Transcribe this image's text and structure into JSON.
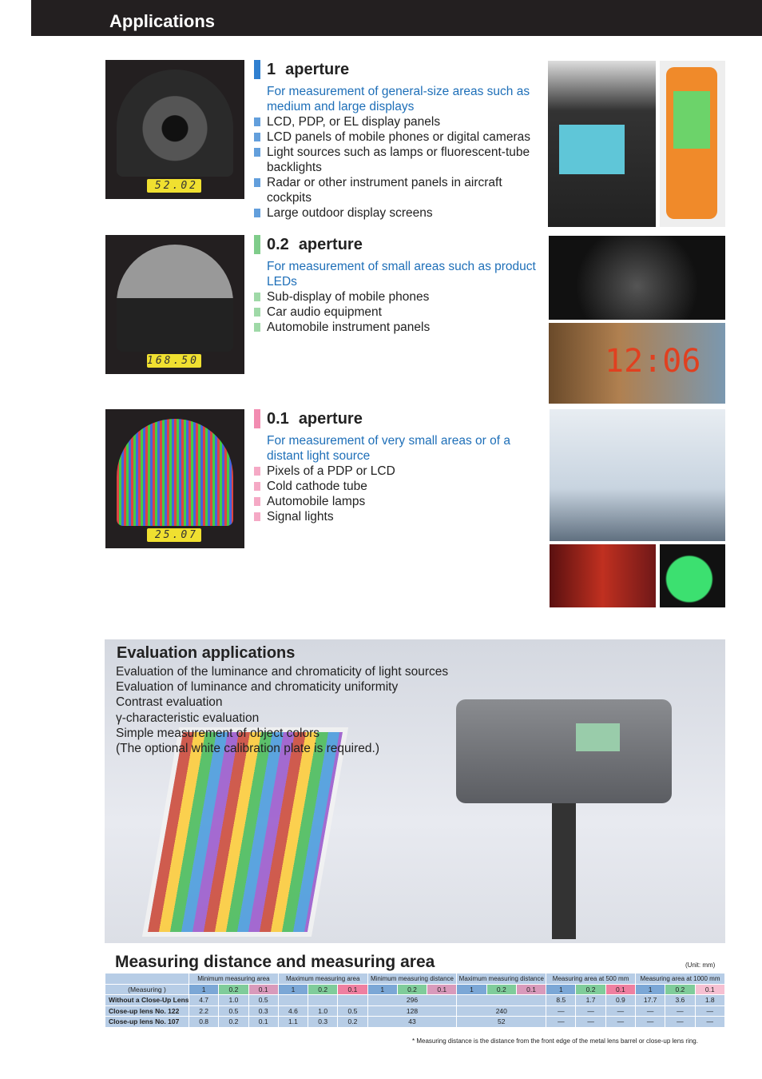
{
  "header": {
    "title": "Applications"
  },
  "sections": [
    {
      "number": "1",
      "label": "aperture",
      "color": "#2f7fd0",
      "readout": "52.02",
      "subtitle": "For measurement of general-size areas such as medium and large displays",
      "items": [
        "LCD, PDP, or EL display panels",
        "LCD panels of mobile phones or digital cameras",
        "Light sources such as lamps or fluorescent-tube backlights",
        "Radar or other instrument panels in aircraft cockpits",
        "Large outdoor display screens"
      ]
    },
    {
      "number": "0.2",
      "label": "aperture",
      "color": "#7fcc8a",
      "readout": "168.50",
      "subtitle": "For measurement of small areas such as product LEDs",
      "items": [
        "Sub-display of mobile phones",
        "Car audio equipment",
        "Automobile instrument panels"
      ]
    },
    {
      "number": "0.1",
      "label": "aperture",
      "color": "#f28cb1",
      "readout": "25.07",
      "subtitle": "For measurement of very small areas or of a distant light source",
      "items": [
        "Pixels of a PDP or LCD",
        "Cold cathode tube",
        "Automobile lamps",
        "Signal lights"
      ]
    }
  ],
  "evaluation": {
    "title": "Evaluation applications",
    "lines": [
      "Evaluation of the luminance and chromaticity of light sources",
      "Evaluation of luminance and chromaticity uniformity",
      "Contrast evaluation",
      "γ-characteristic evaluation",
      "Simple measurement of object colors",
      " (The optional white calibration plate is required.)"
    ]
  },
  "measuring": {
    "title": "Measuring distance and measuring area",
    "unit": "(Unit: mm)",
    "groups": [
      "Minimum measuring area",
      "Maximum measuring area",
      "Minimum measuring distance",
      "Maximum measuring distance",
      "Measuring area at 500 mm",
      "Measuring area at 1000 mm"
    ],
    "aperture_label": "(Measuring        )",
    "apertures": [
      "1",
      "0.2",
      "0.1"
    ],
    "rows": [
      {
        "label": "Without a Close-Up Lens",
        "min_area": [
          "4.7",
          "1.0",
          "0.5"
        ],
        "max_area": [
          "",
          "",
          ""
        ],
        "min_dist": "296",
        "max_dist": "",
        "at500": [
          "8.5",
          "1.7",
          "0.9"
        ],
        "at1000": [
          "17.7",
          "3.6",
          "1.8"
        ]
      },
      {
        "label": "Close-up lens No. 122",
        "min_area": [
          "2.2",
          "0.5",
          "0.3"
        ],
        "max_area": [
          "4.6",
          "1.0",
          "0.5"
        ],
        "min_dist": "128",
        "max_dist": "240",
        "at500": [
          "—",
          "—",
          "—"
        ],
        "at1000": [
          "—",
          "—",
          "—"
        ]
      },
      {
        "label": "Close-up lens No. 107",
        "min_area": [
          "0.8",
          "0.2",
          "0.1"
        ],
        "max_area": [
          "1.1",
          "0.3",
          "0.2"
        ],
        "min_dist": "43",
        "max_dist": "52",
        "at500": [
          "—",
          "—",
          "—"
        ],
        "at1000": [
          "—",
          "—",
          "—"
        ]
      }
    ],
    "note": "* Measuring distance is the distance from the front edge of the metal lens barrel or  close-up lens ring."
  }
}
